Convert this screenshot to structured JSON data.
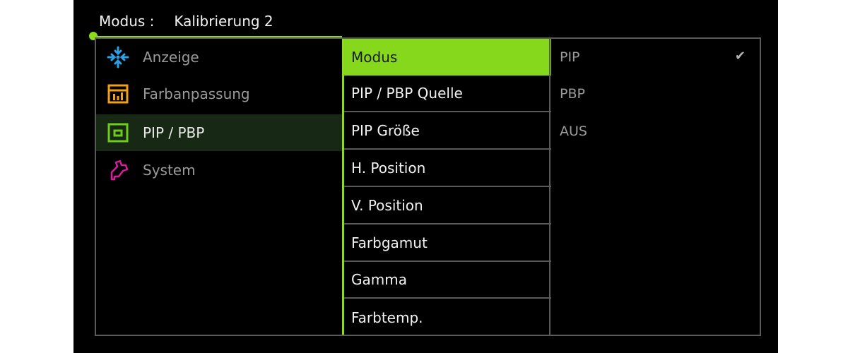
{
  "header": {
    "label": "Modus :",
    "value": "Kalibrierung 2"
  },
  "categories": [
    {
      "label": "Anzeige",
      "icon": "snowflake-arrows-icon",
      "color": "#2aa0e6"
    },
    {
      "label": "Farbanpassung",
      "icon": "color-bars-icon",
      "color": "#f0a019"
    },
    {
      "label": "PIP / PBP",
      "icon": "pip-window-icon",
      "color": "#6ccd1c",
      "active": true
    },
    {
      "label": "System",
      "icon": "wrench-icon",
      "color": "#d81c9c"
    }
  ],
  "submenu": [
    {
      "label": "Modus",
      "active": true
    },
    {
      "label": "PIP / PBP Quelle"
    },
    {
      "label": "PIP Größe"
    },
    {
      "label": "H. Position"
    },
    {
      "label": "V. Position"
    },
    {
      "label": "Farbgamut"
    },
    {
      "label": "Gamma"
    },
    {
      "label": "Farbtemp."
    }
  ],
  "options": [
    {
      "label": "PIP",
      "selected": true,
      "mark": "✔"
    },
    {
      "label": "PBP"
    },
    {
      "label": "AUS"
    }
  ],
  "colors": {
    "accent": "#86d81c",
    "border": "#5a5a5a",
    "background": "#000000"
  }
}
